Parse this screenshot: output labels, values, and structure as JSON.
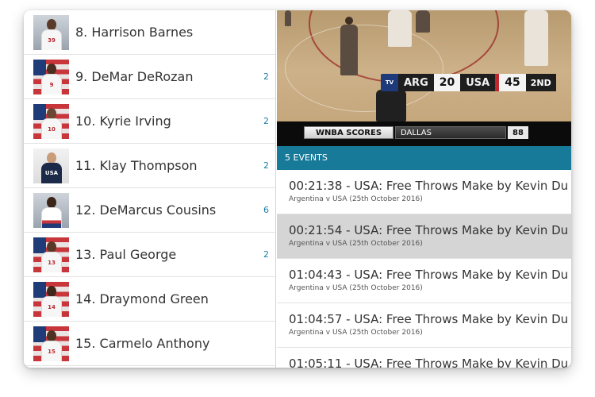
{
  "players": [
    {
      "name": "8. Harrison Barnes",
      "badge": "",
      "jersey": "39"
    },
    {
      "name": "9. DeMar DeRozan",
      "badge": "2",
      "jersey": "9"
    },
    {
      "name": "10. Kyrie Irving",
      "badge": "2",
      "jersey": "10"
    },
    {
      "name": "11. Klay Thompson",
      "badge": "2",
      "jersey": "USA"
    },
    {
      "name": "12. DeMarcus Cousins",
      "badge": "6",
      "jersey": ""
    },
    {
      "name": "13. Paul George",
      "badge": "2",
      "jersey": "13"
    },
    {
      "name": "14. Draymond Green",
      "badge": "",
      "jersey": "14"
    },
    {
      "name": "15. Carmelo Anthony",
      "badge": "",
      "jersey": "15"
    }
  ],
  "video": {
    "scorebug": {
      "logo": "TV",
      "team1": "ARG",
      "score1": "20",
      "team2": "USA",
      "score2": "45",
      "period": "2ND"
    },
    "ticker": {
      "label": "WNBA SCORES",
      "city": "DALLAS",
      "score": "88"
    }
  },
  "events_header": "5 EVENTS",
  "events": [
    {
      "title": "00:21:38 - USA: Free Throws Make by Kevin Du",
      "subtitle": "Argentina v USA (25th October 2016)",
      "selected": false
    },
    {
      "title": "00:21:54 - USA: Free Throws Make by Kevin Du",
      "subtitle": "Argentina v USA (25th October 2016)",
      "selected": true
    },
    {
      "title": "01:04:43 - USA: Free Throws Make by Kevin Du",
      "subtitle": "Argentina v USA (25th October 2016)",
      "selected": false
    },
    {
      "title": "01:04:57 - USA: Free Throws Make by Kevin Du",
      "subtitle": "Argentina v USA (25th October 2016)",
      "selected": false
    },
    {
      "title": "01:05:11 - USA: Free Throws Make by Kevin Du",
      "subtitle": "",
      "selected": false
    }
  ],
  "colors": {
    "accent": "#187a99",
    "badge": "#1a7ea8",
    "selected_row": "#d5d5d5"
  }
}
